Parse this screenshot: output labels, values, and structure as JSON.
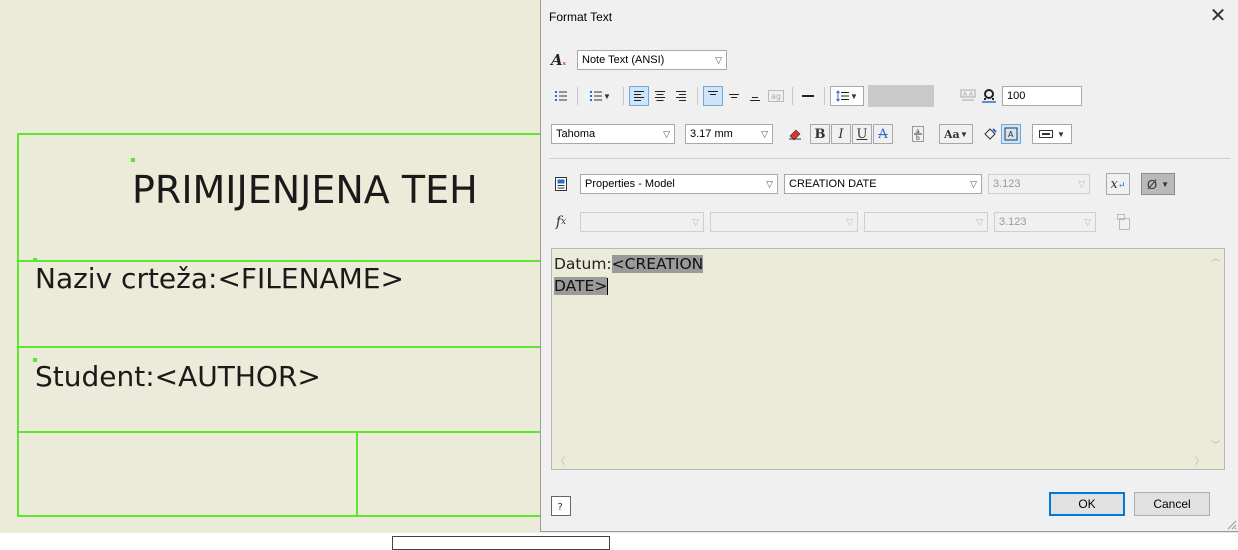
{
  "title_block": {
    "title_text": "PRIMIJENJENA TEH",
    "drawing_name": "Naziv crteža:<FILENAME>",
    "student": "Student:<AUTHOR>"
  },
  "dialog": {
    "title": "Format Text",
    "text_style": "Note Text (ANSI)",
    "width_scale": "100",
    "font": "Tahoma",
    "font_size": "3.17 mm",
    "type": "Properties - Model",
    "property": "CREATION DATE",
    "precision": "3.123",
    "precision2": "3.123",
    "editor": {
      "prefix": "Datum:",
      "line1_highlight": "<CREATION",
      "line2_highlight": "DATE>"
    },
    "ok_label": "OK",
    "cancel_label": "Cancel",
    "null_symbol": "Ø",
    "fx_label": "f",
    "fx_sub": "x",
    "x_label": "x"
  }
}
